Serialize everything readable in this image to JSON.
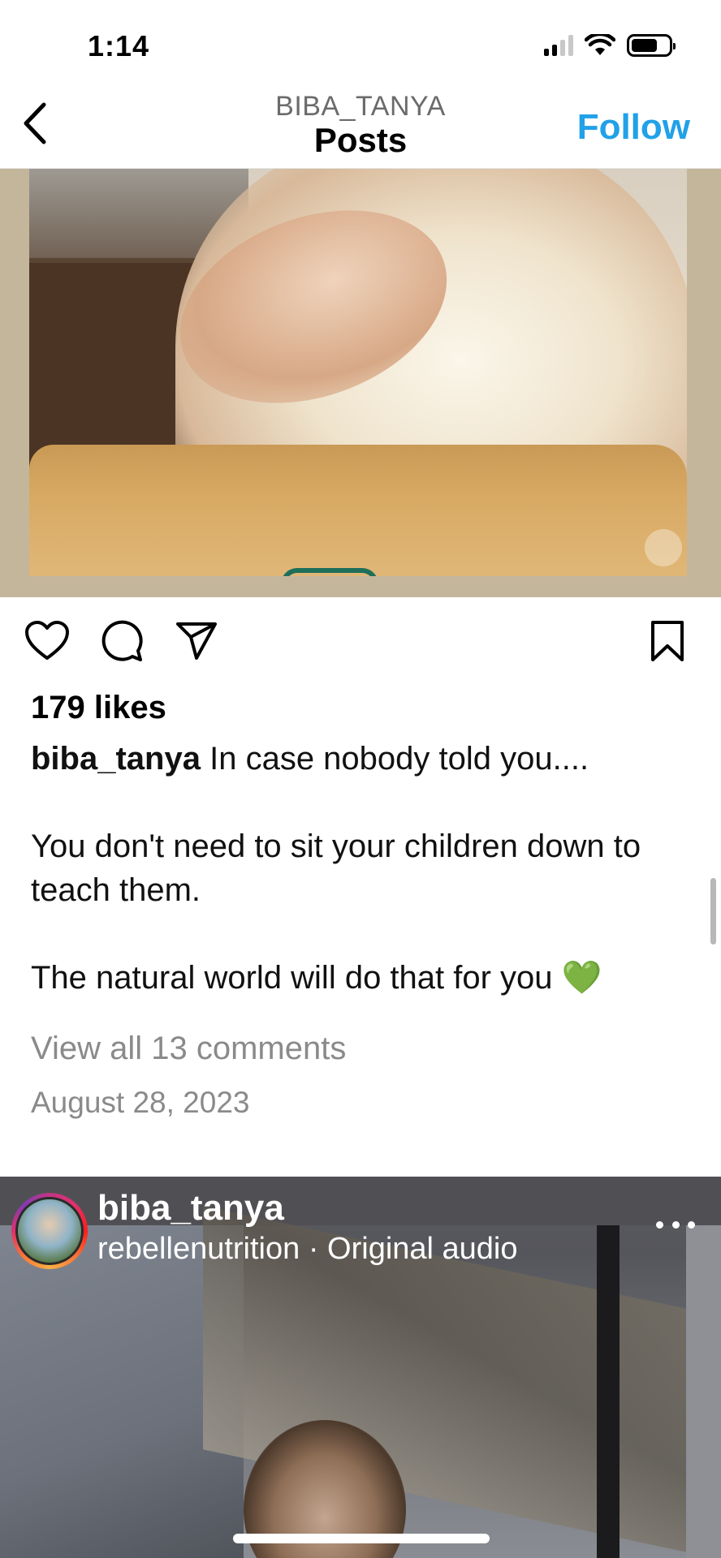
{
  "status_bar": {
    "time": "1:14",
    "icons": [
      "cellular-signal-icon",
      "wifi-icon",
      "battery-icon"
    ]
  },
  "header": {
    "username": "BIBA_TANYA",
    "title": "Posts",
    "follow_label": "Follow",
    "back_icon": "chevron-left-icon"
  },
  "post": {
    "likes": "179 likes",
    "author": "biba_tanya",
    "caption_lines": [
      "In case nobody told you....",
      "",
      "You don't need to sit your children down to teach them.",
      "",
      "The natural world will do that for you 💚"
    ],
    "view_comments": "View all 13 comments",
    "date": "August 28, 2023",
    "action_icons": [
      "heart-icon",
      "comment-icon",
      "share-icon",
      "bookmark-icon"
    ]
  },
  "next_post": {
    "username": "biba_tanya",
    "audio": "rebellenutrition · Original audio",
    "more_icon": "more-horizontal-icon"
  },
  "colors": {
    "accent": "#21a1e8",
    "muted_text": "#8a8a8a"
  }
}
